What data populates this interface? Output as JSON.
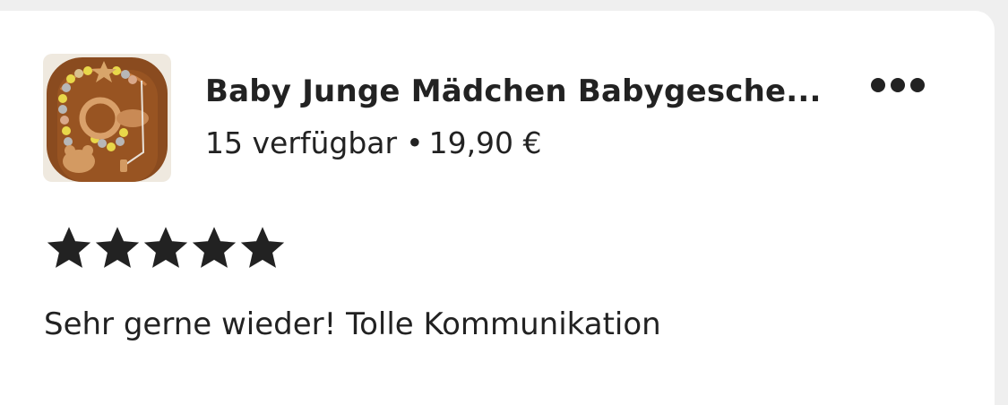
{
  "listing": {
    "title": "Baby Junge Mädchen Babygesche...",
    "available": "15 verfügbar",
    "separator": "•",
    "price": "19,90 €",
    "thumbnail_icon": "product-thumbnail-pacifier-chain"
  },
  "more_menu": {
    "icon": "more-dots-icon"
  },
  "review": {
    "stars": 5,
    "max_stars": 5,
    "text": "Sehr gerne wieder! Tolle Kommunikation"
  },
  "colors": {
    "background": "#efefef",
    "card": "#ffffff",
    "text": "#222222",
    "star": "#222222"
  }
}
